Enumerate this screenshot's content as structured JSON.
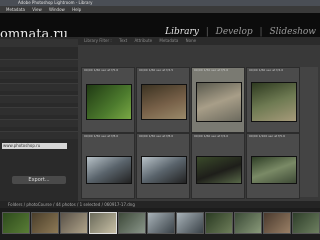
{
  "window": {
    "title": "Adobe Photoshop Lightroom - Library"
  },
  "menu": [
    "Metadata",
    "View",
    "Window",
    "Help"
  ],
  "brand": {
    "logo_text": "omnata.ru"
  },
  "modules": {
    "library": "Library",
    "develop": "Develop",
    "slideshow": "Slideshow"
  },
  "grid_tabs": [
    "Library Filter :",
    "Text",
    "Attribute",
    "Metadata",
    "None"
  ],
  "cells": [
    {
      "meta": "00/00  1/60 sec at f/5.6"
    },
    {
      "meta": "00/00  1/60 sec at f/4.5"
    },
    {
      "meta": "00/00  1/50 sec at f/5.6"
    },
    {
      "meta": "00/00  1/60 sec at f/4.0"
    },
    {
      "meta": "00/00  1/50 sec at f/8.0"
    },
    {
      "meta": "00/00  1/50 sec at f/8.0"
    },
    {
      "meta": "00/00  1/60 sec at f/4.0"
    },
    {
      "meta": "00/00  1/100 sec at f/5.6"
    }
  ],
  "left_panel": {
    "field_text": "www.photoshop.ru",
    "export_button": "Export..."
  },
  "status": {
    "text": "Folders / photoCourse / 44 photos / 1 selected / 060917-17.dng"
  },
  "colors": {
    "accent_photo_green": "#4c7a2d",
    "cell_selected": "#8a8a8a",
    "topbar_black": "#0c0c0c"
  }
}
